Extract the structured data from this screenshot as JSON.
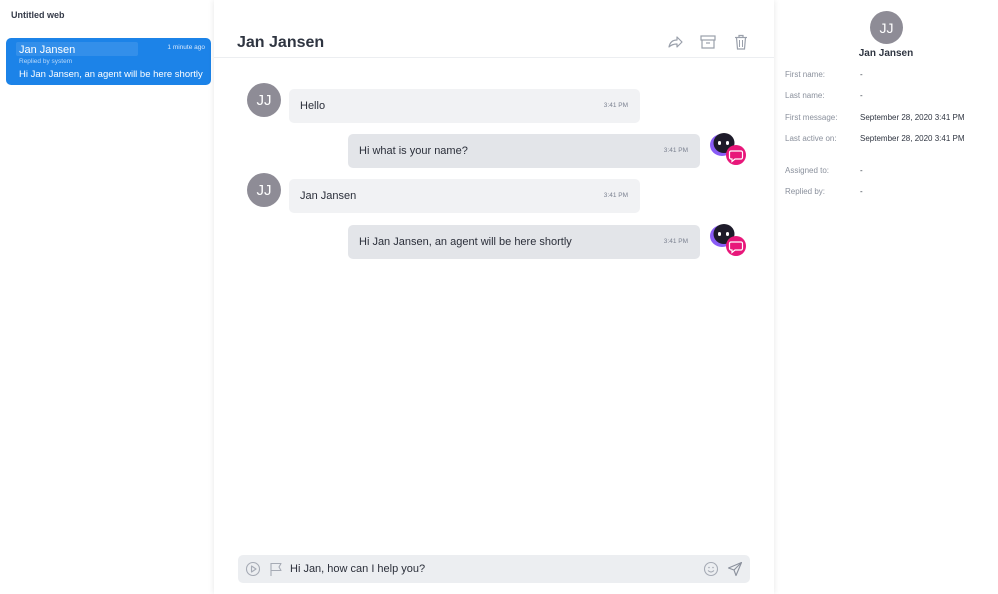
{
  "sidebar": {
    "title": "Untitled web",
    "conversations": [
      {
        "name": "Jan Jansen",
        "time": "1 minute ago",
        "subtitle": "Replied by system",
        "preview": "Hi Jan Jansen, an agent will be here shortly"
      }
    ]
  },
  "chat": {
    "title": "Jan Jansen",
    "header_icons": [
      "share-icon",
      "archive-icon",
      "trash-icon"
    ],
    "messages": [
      {
        "from": "user",
        "avatar": "JJ",
        "text": "Hello",
        "time": "3:41 PM"
      },
      {
        "from": "bot",
        "text": "Hi what is your name?",
        "time": "3:41 PM"
      },
      {
        "from": "user",
        "avatar": "JJ",
        "text": "Jan Jansen",
        "time": "3:41 PM"
      },
      {
        "from": "bot",
        "text": "Hi Jan Jansen, an agent will be here shortly",
        "time": "3:41 PM"
      }
    ],
    "composer": {
      "value": "Hi Jan, how can I help you?",
      "icons": [
        "play-icon",
        "flag-icon",
        "emoji-icon",
        "send-icon"
      ]
    }
  },
  "details": {
    "avatar": "JJ",
    "name": "Jan Jansen",
    "fields": [
      {
        "label": "First name:",
        "value": "-"
      },
      {
        "label": "Last name:",
        "value": "-"
      },
      {
        "label": "First message:",
        "value": "September 28, 2020 3:41 PM"
      },
      {
        "label": "Last active on:",
        "value": "September 28, 2020 3:41 PM"
      },
      {
        "label": "Assigned to:",
        "value": "-"
      },
      {
        "label": "Replied by:",
        "value": "-"
      }
    ]
  },
  "colors": {
    "accent": "#1c83e8",
    "bot_purple": "#8a5cf6",
    "bot_pink": "#e8177a",
    "avatar_gray": "#8e8c96"
  }
}
